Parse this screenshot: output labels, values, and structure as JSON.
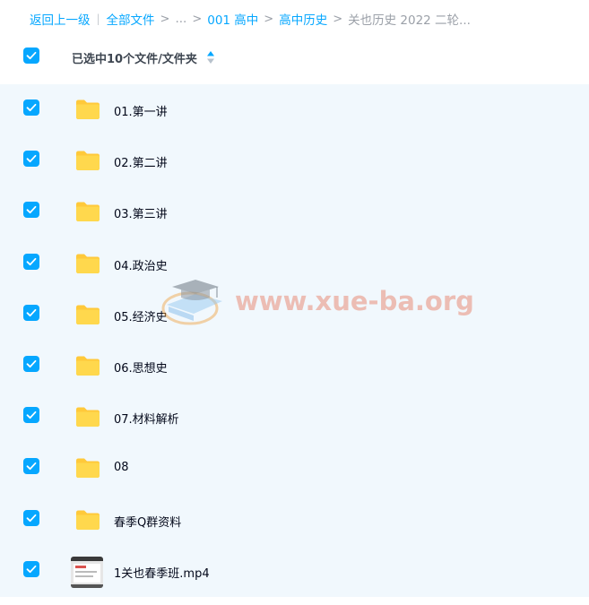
{
  "breadcrumb": {
    "back": "返回上一级",
    "all_files": "全部文件",
    "ellipsis": "...",
    "level1": "001 高中",
    "level2": "高中历史",
    "current": "关也历史 2022 二轮..."
  },
  "header": {
    "selection_label": "已选中10个文件/文件夹"
  },
  "files": [
    {
      "name": "01.第一讲",
      "type": "folder"
    },
    {
      "name": "02.第二讲",
      "type": "folder"
    },
    {
      "name": "03.第三讲",
      "type": "folder"
    },
    {
      "name": "04.政治史",
      "type": "folder"
    },
    {
      "name": "05.经济史",
      "type": "folder"
    },
    {
      "name": "06.思想史",
      "type": "folder"
    },
    {
      "name": "07.材料解析",
      "type": "folder"
    },
    {
      "name": "08",
      "type": "folder"
    },
    {
      "name": "春季Q群资料",
      "type": "folder"
    },
    {
      "name": "1关也春季班.mp4",
      "type": "video"
    }
  ],
  "watermark": {
    "text": "www.xue-ba.org"
  },
  "colors": {
    "accent": "#06a7ff",
    "list_background": "#f1f8fd",
    "folder": "#ffd34d"
  }
}
